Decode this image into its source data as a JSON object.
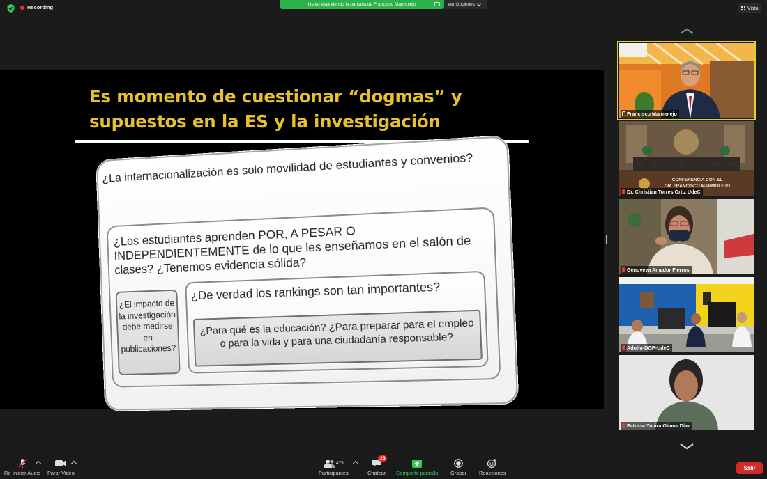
{
  "top_bar": {
    "recording_label": "Recording",
    "share_banner": "Usted está viendo la pantalla de Francisco Marmolejo",
    "view_options": "Ver Opciones",
    "view_label": "Vista"
  },
  "slide": {
    "title_line1": "Es momento de cuestionar “dogmas” y",
    "title_line2": "supuestos en la ES y la investigación",
    "q_internacionalizacion": "¿La internacionalización es solo movilidad de estudiantes y convenios?",
    "q_estudiantes": "¿Los estudiantes aprenden POR, A PESAR O INDEPENDIENTEMENTE de lo que les enseñamos en el salón de clases? ¿Tenemos evidencia sólida?",
    "q_impacto": "¿El impacto de la investigación debe medirse en publicaciones?",
    "q_rankings": "¿De verdad los rankings son tan importantes?",
    "q_educacion": "¿Para qué es la educación? ¿Para preparar para el empleo o para la vida y para una ciudadanía responsable?"
  },
  "gallery": {
    "participants": [
      {
        "name": "Francisco Marmolejo",
        "muted": false,
        "active_speaker": true
      },
      {
        "name": "Dr. Christian Torres Ortiz UdeC",
        "muted": true,
        "active_speaker": false,
        "overlay_line1": "CONFERENCIA CON EL",
        "overlay_line2": "DR. FRANCISCO MARMOLEJO"
      },
      {
        "name": "Genoveva Amador Fierros",
        "muted": true,
        "active_speaker": false
      },
      {
        "name": "Adolfo-DGP-UdeC",
        "muted": true,
        "active_speaker": false
      },
      {
        "name": "Patricia Yanira Olmos Díaz",
        "muted": true,
        "active_speaker": false
      }
    ]
  },
  "toolbar": {
    "audio_label": "Re-Iniciar Audio",
    "video_label": "Parar Video",
    "participants_label": "Participantes",
    "participants_count": "475",
    "chat_label": "Chatear",
    "chat_badge": "25",
    "share_label": "Compartir pantalla",
    "record_label": "Grabar",
    "reactions_label": "Reacciones",
    "leave_label": "Salir"
  },
  "colors": {
    "slide_title": "#e5c12e",
    "share_green": "#2bb24a",
    "leave_red": "#d22a2a",
    "active_speaker_outline": "#dcd32a"
  }
}
